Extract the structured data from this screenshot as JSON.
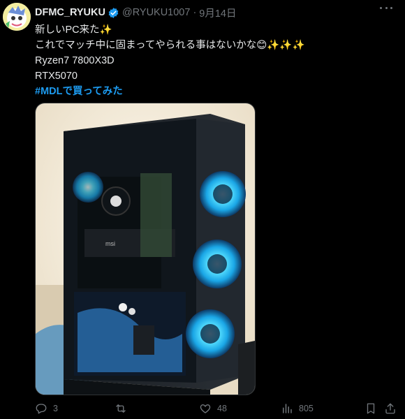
{
  "user": {
    "display_name": "DFMC_RYUKU",
    "handle": "@RYUKU1007",
    "separator": "·",
    "date": "9月14日"
  },
  "tweet": {
    "lines": [
      "新しいPC来た✨",
      "これでマッチ中に固まってやられる事はないかな😊✨✨✨",
      "Ryzen7 7800X3D",
      "RTX5070"
    ],
    "hashtag": "#MDLで買ってみた"
  },
  "media": {
    "description_icon": "pc-case-photo"
  },
  "actions": {
    "replies": "3",
    "retweets": "",
    "likes": "48",
    "views": "805"
  },
  "colors": {
    "background": "#000000",
    "text": "#e7e9ea",
    "muted": "#71767b",
    "accent": "#1d9bf0"
  }
}
